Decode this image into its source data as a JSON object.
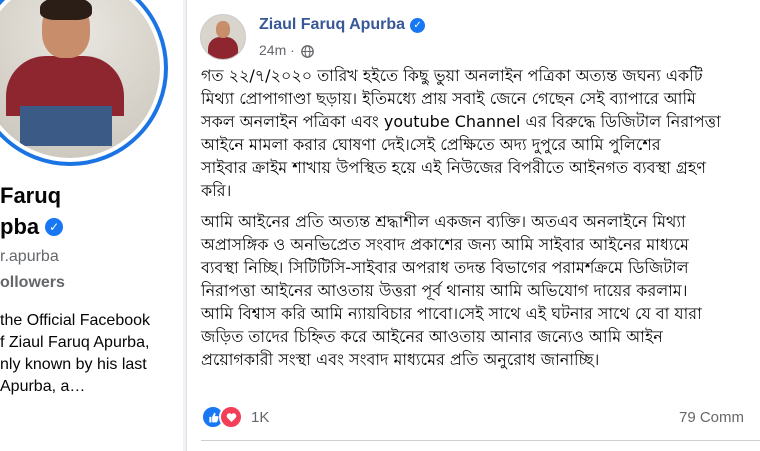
{
  "profile": {
    "name_line1": "Faruq",
    "name_line2": "pba",
    "handle": "r.apurba",
    "followers": "ollowers",
    "about": "the Official Facebook\nf Ziaul Faruq Apurba,\nnly known by his last\nApurba, a…"
  },
  "post": {
    "author": "Ziaul Faruq Apurba",
    "time": "24m",
    "separator": "·",
    "paragraphs": [
      [
        "গত ২২/৭/২০২০ তারিখ হইতে কিছু ভুয়া অনলাইন পত্রিকা অত্যন্ত জঘন্য একটি",
        "মিথ্যা প্রোপাগাণ্ডা ছড়ায়। ইতিমধ্যে প্রায় সবাই জেনে গেছেন সেই ব্যাপারে আমি",
        "সকল অনলাইন পত্রিকা এবং youtube Channel এর বিরুদ্ধে ডিজিটাল নিরাপত্তা",
        "আইনে মামলা করার ঘোষণা দেই।সেই প্রেক্ষিতে অদ্য দুপুরে আমি পুলিশের",
        "সাইবার ক্রাইম শাখায় উপস্থিত হয়ে এই নিউজের বিপরীতে আইনগত ব্যবস্থা গ্রহণ",
        "করি।"
      ],
      [
        "আমি আইনের প্রতি অত্যন্ত শ্রদ্ধাশীল একজন ব্যক্তি। অতএব অনলাইনে মিথ্যা",
        "অপ্রাসঙ্গিক ও অনভিপ্রেত সংবাদ প্রকাশের জন্য আমি সাইবার আইনের মাধ্যমে",
        "ব্যবস্থা নিচ্ছি। সিটিটিসি-সাইবার অপরাধ তদন্ত বিভাগের পরামর্শক্রমে ডিজিটাল",
        "নিরাপত্তা আইনের আওতায় উত্তরা পূর্ব থানায় আমি অভিযোগ দায়ের করলাম।",
        "আমি বিশ্বাস করি আমি ন্যায়বিচার পাবো।সেই সাথে এই ঘটনার সাথে যে বা যারা",
        "জড়িত তাদের চিহ্নিত করে আইনের আওতায় আনার জন্যেও আমি আইন",
        "প্রয়োগকারী সংস্থা এবং সংবাদ মাধ্যমের প্রতি অনুরোধ জানাচ্ছি।"
      ]
    ],
    "reactions_count": "1K",
    "comments": "79 Comm"
  },
  "icons": {
    "like": "like-icon",
    "love": "love-icon",
    "globe": "globe-icon",
    "verified": "verified-badge-icon"
  },
  "colors": {
    "accent": "#1877f2",
    "author": "#385898",
    "love": "#f33e58"
  }
}
